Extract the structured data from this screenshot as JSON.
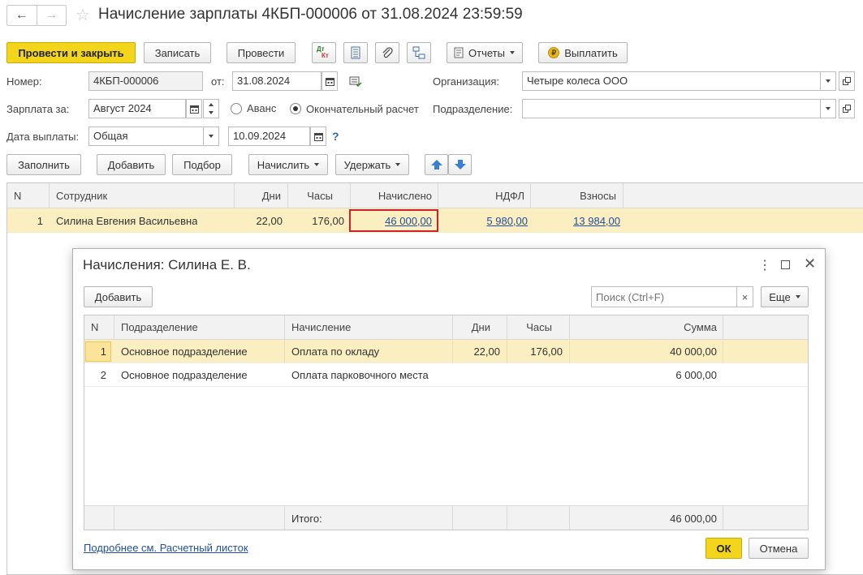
{
  "title": "Начисление зарплаты 4КБП-000006 от 31.08.2024 23:59:59",
  "toolbar": {
    "post_close": "Провести и закрыть",
    "save": "Записать",
    "post": "Провести",
    "reports": "Отчеты",
    "pay": "Выплатить",
    "dt_kt_top": "Дт",
    "dt_kt_bottom": "Кт"
  },
  "form": {
    "number_label": "Номер:",
    "number_value": "4КБП-000006",
    "from_label": "от:",
    "date_value": "31.08.2024",
    "org_label": "Организация:",
    "org_value": "Четыре колеса ООО",
    "salary_for_label": "Зарплата за:",
    "salary_for_value": "Август 2024",
    "advance_label": "Аванс",
    "final_label": "Окончательный расчет",
    "division_label": "Подразделение:",
    "division_value": "",
    "pay_date_label": "Дата выплаты:",
    "pay_type_value": "Общая",
    "pay_date_value": "10.09.2024",
    "help_mark": "?"
  },
  "table_toolbar": {
    "fill": "Заполнить",
    "add": "Добавить",
    "pick": "Подбор",
    "accrue": "Начислить",
    "withhold": "Удержать"
  },
  "main_table": {
    "headers": [
      "N",
      "Сотрудник",
      "Дни",
      "Часы",
      "Начислено",
      "НДФЛ",
      "Взносы"
    ],
    "rows": [
      {
        "n": "1",
        "employee": "Силина Евгения Васильевна",
        "days": "22,00",
        "hours": "176,00",
        "accrued": "46 000,00",
        "ndfl": "5 980,00",
        "contrib": "13 984,00"
      }
    ]
  },
  "dialog": {
    "title": "Начисления: Силина Е. В.",
    "add": "Добавить",
    "search_placeholder": "Поиск (Ctrl+F)",
    "clear": "×",
    "more": "Еще",
    "headers": [
      "N",
      "Подразделение",
      "Начисление",
      "Дни",
      "Часы",
      "Сумма"
    ],
    "rows": [
      {
        "n": "1",
        "division": "Основное подразделение",
        "accrual": "Оплата по окладу",
        "days": "22,00",
        "hours": "176,00",
        "sum": "40 000,00"
      },
      {
        "n": "2",
        "division": "Основное подразделение",
        "accrual": "Оплата парковочного места",
        "days": "",
        "hours": "",
        "sum": "6 000,00"
      }
    ],
    "total_label": "Итого:",
    "total_sum": "46 000,00",
    "details_link": "Подробнее см. Расчетный листок",
    "ok": "ОК",
    "cancel": "Отмена"
  },
  "colors": {
    "accent": "#f3d51b",
    "selected_row": "#fbeec0",
    "highlight_border": "#d0202a",
    "link": "#1f4e9e"
  }
}
